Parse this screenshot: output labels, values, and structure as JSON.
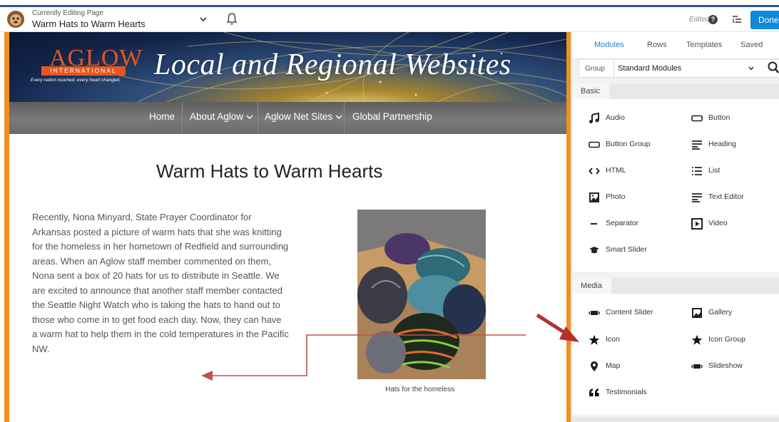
{
  "builder": {
    "editing_label": "Currently Editing Page",
    "page_name": "Warm Hats to Warm Hearts",
    "edited_label": "Edited",
    "done_label": "Done"
  },
  "site": {
    "logo_word": "AGLOW",
    "logo_sub": "INTERNATIONAL",
    "logo_tagline": "Every nation touched, every heart changed.",
    "banner_title": "Local and Regional Websites",
    "nav": [
      {
        "label": "Home"
      },
      {
        "label": "About Aglow"
      },
      {
        "label": "Aglow Net Sites"
      },
      {
        "label": "Global Partnership"
      }
    ]
  },
  "content": {
    "title": "Warm Hats to Warm Hearts",
    "body": "Recently, Nona Minyard, State Prayer Coordinator for Arkansas posted a picture of warm hats that she was knitting for the homeless in her hometown of Redfield and surrounding areas. When an Aglow staff member commented on them, Nona sent a box of 20 hats for us to distribute in Seattle. We are excited to announce that another staff member contacted the Seattle Night Watch who is taking the hats to hand out to those who come in to get food each day. Now, they can have a warm hat to help them in the cold temperatures in the Pacific NW.",
    "photo_caption": "Hats for the homeless"
  },
  "panel": {
    "tabs": [
      "Modules",
      "Rows",
      "Templates",
      "Saved"
    ],
    "group_label": "Group",
    "group_value": "Standard Modules",
    "sections": {
      "basic": {
        "title": "Basic",
        "modules": [
          {
            "label": "Audio",
            "icon": "music-icon"
          },
          {
            "label": "Button",
            "icon": "button-icon"
          },
          {
            "label": "Button Group",
            "icon": "button-group-icon"
          },
          {
            "label": "Heading",
            "icon": "heading-icon"
          },
          {
            "label": "HTML",
            "icon": "code-icon"
          },
          {
            "label": "List",
            "icon": "list-icon"
          },
          {
            "label": "Photo",
            "icon": "photo-icon"
          },
          {
            "label": "Text Editor",
            "icon": "text-editor-icon"
          },
          {
            "label": "Separator",
            "icon": "separator-icon"
          },
          {
            "label": "Video",
            "icon": "video-icon"
          },
          {
            "label": "Smart Slider",
            "icon": "smart-slider-icon"
          }
        ]
      },
      "media": {
        "title": "Media",
        "modules": [
          {
            "label": "Content Slider",
            "icon": "slider-icon"
          },
          {
            "label": "Gallery",
            "icon": "gallery-icon"
          },
          {
            "label": "Icon",
            "icon": "star-icon"
          },
          {
            "label": "Icon Group",
            "icon": "star-icon"
          },
          {
            "label": "Map",
            "icon": "map-pin-icon"
          },
          {
            "label": "Slideshow",
            "icon": "slideshow-icon"
          },
          {
            "label": "Testimonials",
            "icon": "quote-icon"
          }
        ]
      }
    }
  },
  "colors": {
    "accent_blue": "#0e8ad8",
    "frame_orange": "#ef8f1f",
    "annotation_red": "#b5302c"
  }
}
